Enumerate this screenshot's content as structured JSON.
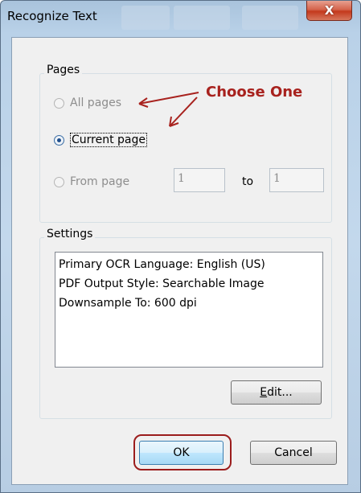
{
  "window": {
    "title": "Recognize Text",
    "close_glyph": "X"
  },
  "pages": {
    "label": "Pages",
    "annotation": "Choose One",
    "options": [
      {
        "label": "All pages",
        "selected": false,
        "enabled": false
      },
      {
        "label": "Current page",
        "selected": true,
        "enabled": true
      },
      {
        "label": "From page",
        "selected": false,
        "enabled": false
      }
    ],
    "from_value": "1",
    "to_label": "to",
    "to_value": "1"
  },
  "settings": {
    "label": "Settings",
    "lines": [
      "Primary OCR Language: English (US)",
      "PDF Output Style: Searchable Image",
      "Downsample To: 600 dpi"
    ],
    "edit_label_mnemonic": "E",
    "edit_label_rest": "dit..."
  },
  "footer": {
    "ok_label": "OK",
    "cancel_label": "Cancel"
  },
  "colors": {
    "annotation": "#a8221e",
    "titlebar": "#b9d1e8",
    "close_button": "#c3391c"
  }
}
